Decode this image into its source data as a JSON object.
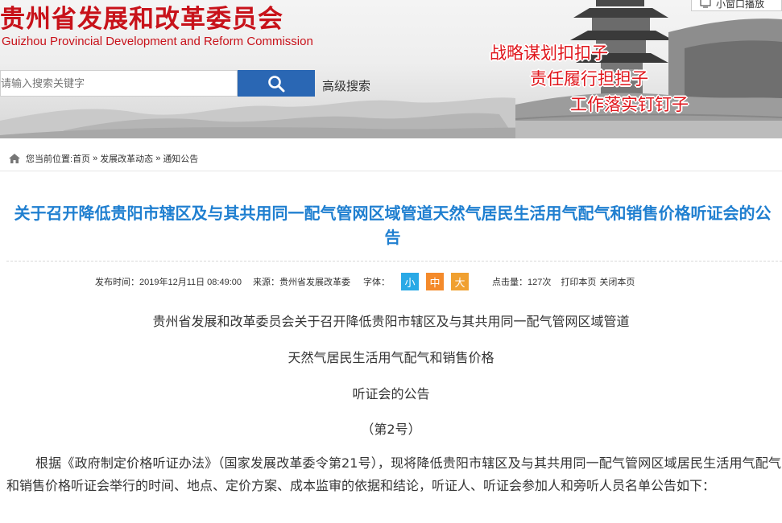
{
  "header": {
    "site_title": "贵州省发展和改革委员会",
    "site_subtitle": "Guizhou Provincial Development and Reform Commission",
    "search_placeholder": "请输入搜索关键字",
    "search_icon": "search-icon",
    "advanced_search": "高级搜索",
    "small_window_label": "小窗口播放",
    "slogans": [
      "战略谋划扣扣子",
      "责任履行担担子",
      "工作落实钉钉子"
    ],
    "colors": {
      "brand_red": "#c8121a",
      "slogan_red": "#e0161c",
      "search_blue": "#2a67b4"
    }
  },
  "breadcrumb": {
    "prefix": "您当前位置:",
    "items": [
      "首页",
      "发展改革动态",
      "通知公告"
    ],
    "separator": "»"
  },
  "article": {
    "title": "关于召开降低贵阳市辖区及与其共用同一配气管网区域管道天然气居民生活用气配气和销售价格听证会的公告",
    "meta": {
      "publish_label": "发布时间：",
      "publish_time": "2019年12月11日 08:49:00",
      "source_label": "来源：",
      "source": "贵州省发展改革委",
      "font_label": "字体：",
      "font_sizes": [
        "小",
        "中",
        "大"
      ],
      "clicks_label": "点击量：",
      "clicks": "127次",
      "print": "打印本页",
      "close": "关闭本页"
    },
    "heading_lines": [
      "贵州省发展和改革委员会关于召开降低贵阳市辖区及与其共用同一配气管网区域管道",
      "天然气居民生活用气配气和销售价格",
      "听证会的公告",
      "（第2号）"
    ],
    "body": "根据《政府制定价格听证办法》（国家发展改革委令第21号），现将降低贵阳市辖区及与其共用同一配气管网区域居民生活用气配气和销售价格听证会举行的时间、地点、定价方案、成本监审的依据和结论，听证人、听证会参加人和旁听人员名单公告如下：",
    "colors": {
      "title_blue": "#1f7fd0"
    }
  }
}
